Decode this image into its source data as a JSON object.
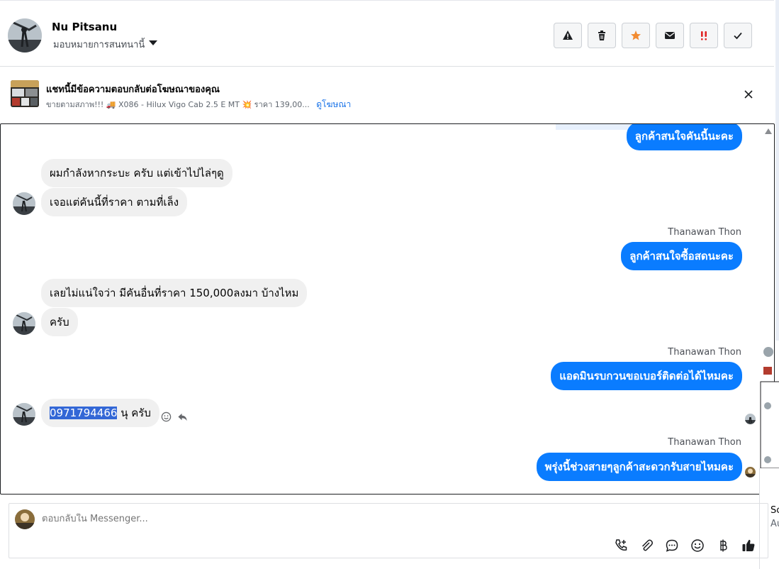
{
  "header": {
    "name": "Nu Pitsanu",
    "assign_label": "มอบหมายการสนทนานี้",
    "actions": [
      {
        "icon": "warning-icon"
      },
      {
        "icon": "trash-icon"
      },
      {
        "icon": "star-icon",
        "color": "#f28b31"
      },
      {
        "icon": "envelope-icon"
      },
      {
        "icon": "double-exclamation-icon",
        "color": "#e02424"
      },
      {
        "icon": "check-icon"
      }
    ]
  },
  "ad": {
    "title": "แชทนี้มีข้อความตอบกลับต่อโฆษณาของคุณ",
    "description": "ขายตามสภาพ!!! 🚚 X086 - Hilux Vigo Cab 2.5 E MT 💥 ราคา 139,00...",
    "link": "ดูโฆษณา"
  },
  "messages": {
    "m1": "ลูกค้าสนใจคันนี้นะคะ",
    "m2": "ผมกำลังหากระบะ ครับ แต่เข้าไปไล่ๆดู",
    "m3": "เจอแต่คันนี้ที่ราคา ตามที่เล็ง",
    "sender1": "Thanawan Thon",
    "m4": "ลูกค้าสนใจซื้อสดนะคะ",
    "m5": "เลยไม่แน่ใจว่า มีคันอื่นที่ราคา 150,000ลงมา บ้างไหม",
    "m6": "ครับ",
    "sender2": "Thanawan Thon",
    "m7": "แอดมินรบกวนขอเบอร์ติดต่อได้ไหมคะ",
    "m8_highlight": "0971794466",
    "m8_rest": " นุ ครับ",
    "sender3": "Thanawan Thon",
    "m9": "พรุ่งนี้ช่วงสายๆลูกค้าสะดวกรับสายไหมคะ"
  },
  "composer": {
    "placeholder": "ตอบกลับใน Messenger...",
    "icons": [
      "call-add-icon",
      "paperclip-icon",
      "chat-bubble-icon",
      "emoji-icon",
      "baht-icon",
      "thumbs-up-icon"
    ]
  },
  "side_panel": {
    "text1": "Sc",
    "text2": "Au"
  },
  "colors": {
    "outgoing_bubble": "#0a7cff",
    "incoming_bubble": "#f0f0f0",
    "link": "#1a73e8"
  }
}
